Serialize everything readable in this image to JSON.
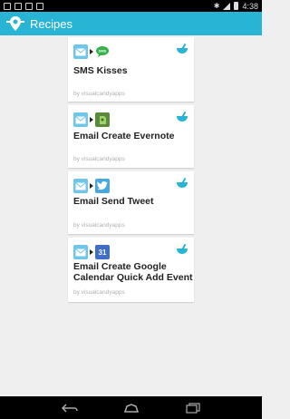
{
  "status_bar": {
    "time": "4:38"
  },
  "action_bar": {
    "title": "Recipes"
  },
  "recipes": [
    {
      "title": "SMS Kisses",
      "author": "by visualcandyapps",
      "trigger_icon": "email-icon",
      "action_icon": "sms-icon",
      "sms_label": "SMS"
    },
    {
      "title": "Email Create Evernote",
      "author": "by visualcandyapps",
      "trigger_icon": "email-icon",
      "action_icon": "evernote-icon"
    },
    {
      "title": "Email Send Tweet",
      "author": "by visualcandyapps",
      "trigger_icon": "email-icon",
      "action_icon": "twitter-icon"
    },
    {
      "title": "Email Create Google Calendar Quick Add Event",
      "author": "by visualcandyapps",
      "trigger_icon": "email-icon",
      "action_icon": "google-calendar-icon",
      "calendar_day": "31"
    }
  ],
  "colors": {
    "accent": "#28b4d4",
    "background": "#efefef",
    "card": "#ffffff",
    "author_text": "#b0b0b0"
  }
}
